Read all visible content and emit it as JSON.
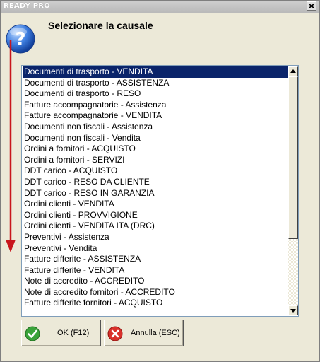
{
  "window": {
    "title": "READY PRO",
    "prompt": "Selezionare la causale"
  },
  "list": {
    "selected_index": 0,
    "items": [
      "Documenti di trasporto - VENDITA",
      "Documenti di trasporto - ASSISTENZA",
      "Documenti di trasporto - RESO",
      "Fatture accompagnatorie - Assistenza",
      "Fatture accompagnatorie - VENDITA",
      "Documenti non fiscali - Assistenza",
      "Documenti non fiscali - Vendita",
      "Ordini a fornitori - ACQUISTO",
      "Ordini a fornitori - SERVIZI",
      "DDT carico - ACQUISTO",
      "DDT carico - RESO DA CLIENTE",
      "DDT carico - RESO IN GARANZIA",
      "Ordini clienti - VENDITA",
      "Ordini clienti - PROVVIGIONE",
      "Ordini clienti - VENDITA ITA (DRC)",
      "Preventivi - Assistenza",
      "Preventivi - Vendita",
      "Fatture differite - ASSISTENZA",
      "Fatture differite - VENDITA",
      "Note di accredito - ACCREDITO",
      "Note di accredito fornitori - ACCREDITO",
      "Fatture differite fornitori - ACQUISTO"
    ]
  },
  "buttons": {
    "ok_label": "OK (F12)",
    "cancel_label": "Annulla (ESC)"
  },
  "colors": {
    "selection": "#0a246a",
    "arrow": "#c8161d",
    "dialog_bg": "#ece9d8"
  },
  "icons": [
    "close-icon",
    "help-icon",
    "down-arrow-icon",
    "scroll-up-icon",
    "scroll-down-icon",
    "check-icon",
    "cancel-icon"
  ]
}
